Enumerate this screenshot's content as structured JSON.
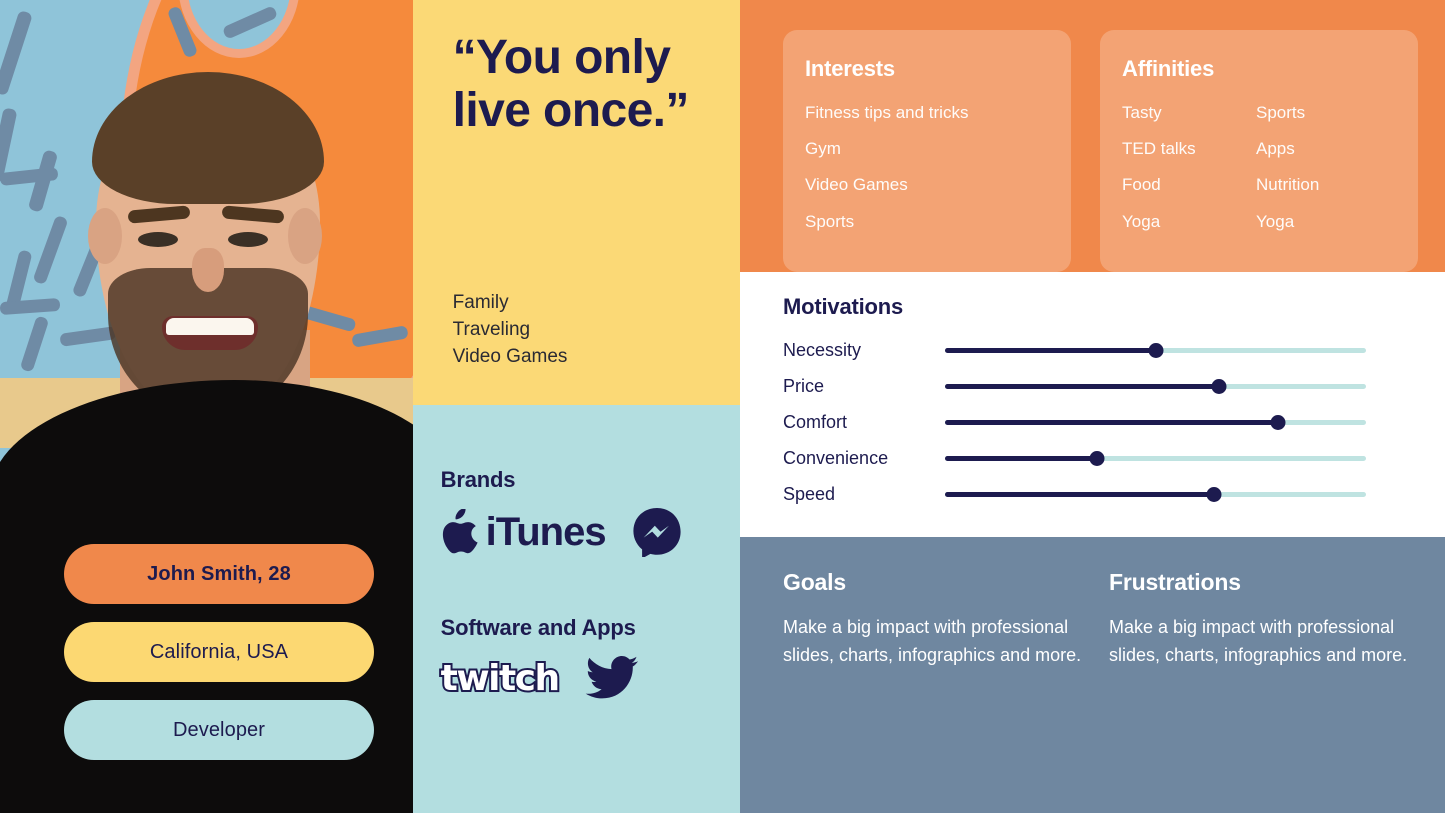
{
  "profile": {
    "name_age": "John Smith, 28",
    "location": "California, USA",
    "role": "Developer",
    "photo_alt": "smiling-man-portrait"
  },
  "quote": {
    "line1": "“You only",
    "line2": "live once.”"
  },
  "hobbies": {
    "items": [
      "Family",
      "Traveling",
      "Video Games"
    ]
  },
  "brands": {
    "title": "Brands",
    "logos": [
      "apple-itunes-logo",
      "facebook-messenger-logo"
    ],
    "itunes_label": "iTunes"
  },
  "software": {
    "title": "Software and Apps",
    "twitch_label": "twitch",
    "logos": [
      "twitch-logo",
      "twitter-logo"
    ]
  },
  "interests": {
    "title": "Interests",
    "items": [
      "Fitness tips and tricks",
      "Gym",
      "Video Games",
      "Sports"
    ]
  },
  "affinities": {
    "title": "Affinities",
    "items": [
      "Tasty",
      "Sports",
      "TED talks",
      "Apps",
      "Food",
      "Nutrition",
      "Yoga",
      "Yoga"
    ]
  },
  "motivations": {
    "title": "Motivations",
    "rows": [
      {
        "label": "Necessity",
        "value": 50
      },
      {
        "label": "Price",
        "value": 65
      },
      {
        "label": "Comfort",
        "value": 79
      },
      {
        "label": "Convenience",
        "value": 36
      },
      {
        "label": "Speed",
        "value": 64
      }
    ]
  },
  "goals": {
    "title": "Goals",
    "text": "Make a big impact with professional slides, charts, infographics and more."
  },
  "frustrations": {
    "title": "Frustrations",
    "text": "Make a big impact with professional slides, charts, infographics and more."
  },
  "colors": {
    "navy": "#1d1b4f",
    "orange": "#f0884b",
    "yellow": "#fbd976",
    "teal": "#b3dee0",
    "slate": "#6f87a0",
    "track": "#bfe3e1"
  }
}
